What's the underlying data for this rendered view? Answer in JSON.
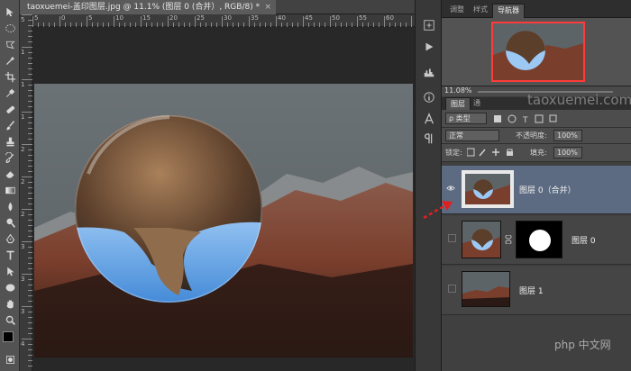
{
  "document": {
    "tab_title": "taoxuemei-盖印图层.jpg @ 11.1% (图层 0 (合并）, RGB/8) *",
    "close_glyph": "×"
  },
  "ruler": {
    "h_labels": [
      "5",
      "0",
      "5",
      "10",
      "15",
      "20",
      "25",
      "30",
      "35",
      "40",
      "45",
      "50",
      "55",
      "60"
    ],
    "v_labels": [
      "5",
      "1",
      "1",
      "1",
      "2",
      "2",
      "2",
      "3",
      "3",
      "3",
      "4"
    ]
  },
  "panels": {
    "nav_tabs": [
      "调整",
      "样式",
      "导航器"
    ],
    "zoom_value": "11.08%",
    "layer_tabs": [
      "图层",
      "通"
    ],
    "filter_label": "ρ 类型",
    "blend_mode": "正常",
    "opacity_label": "不透明度:",
    "opacity_value": "100%",
    "lock_label": "锁定:",
    "fill_label": "填充:",
    "fill_value": "100%"
  },
  "layers": [
    {
      "name": "图层 0（合并）",
      "selected": true,
      "visible": true
    },
    {
      "name": "图层 0",
      "selected": false,
      "visible": false
    },
    {
      "name": "图层 1",
      "selected": false,
      "visible": false
    }
  ],
  "watermark": {
    "brand": "taoxuemei.com",
    "php": "php 中文网"
  },
  "colors": {
    "selection": "#5c6b82",
    "arrow": "#e02020",
    "nav_frame": "#ff3b3b"
  },
  "icons": [
    "move-icon",
    "marquee-icon",
    "lasso-icon",
    "magic-wand-icon",
    "crop-icon",
    "eyedropper-icon",
    "healing-icon",
    "brush-icon",
    "stamp-icon",
    "history-brush-icon",
    "eraser-icon",
    "gradient-icon",
    "blur-icon",
    "dodge-icon",
    "pen-icon",
    "type-icon",
    "path-select-icon",
    "shape-icon",
    "hand-icon",
    "zoom-icon"
  ]
}
